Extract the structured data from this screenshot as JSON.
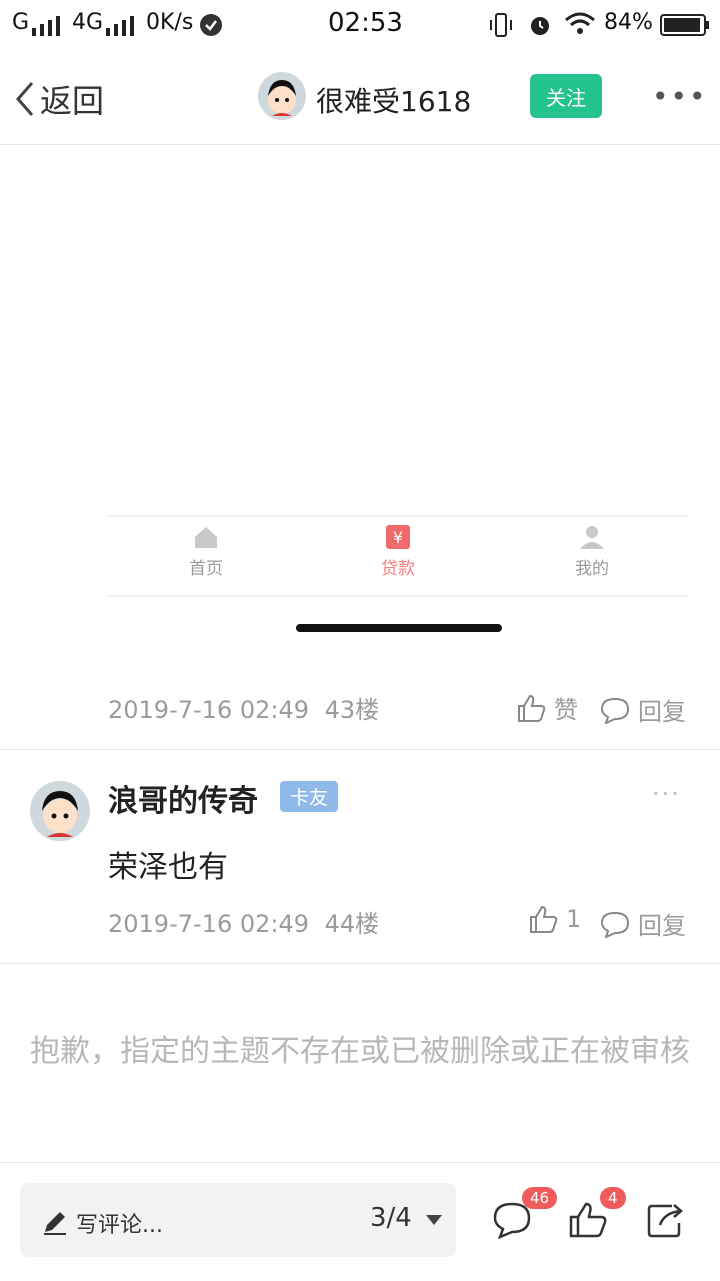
{
  "status_bar": {
    "signal1": "G",
    "signal2": "4G",
    "speed": "0K/s",
    "time": "02:53",
    "battery": "84%"
  },
  "header": {
    "back_label": "返回",
    "username": "很难受1618",
    "follow_label": "关注",
    "more_label": "•••"
  },
  "embedded_screenshot": {
    "tabs": [
      {
        "label": "首页",
        "icon": "home-icon"
      },
      {
        "label": "贷款",
        "icon": "yen-icon"
      },
      {
        "label": "我的",
        "icon": "person-icon"
      }
    ]
  },
  "post43": {
    "datetime": "2019-7-16 02:49",
    "floor": "43楼",
    "like_label": "赞",
    "reply_label": "回复"
  },
  "post44": {
    "username": "浪哥的传奇",
    "badge": "卡友",
    "comment": "荣泽也有",
    "datetime": "2019-7-16 02:49",
    "floor": "44楼",
    "like_count": "1",
    "reply_label": "回复",
    "more_label": "···"
  },
  "notice": "抱歉，指定的主题不存在或已被删除或正在被审核",
  "bottom_bar": {
    "write_label": "写评论...",
    "page_indicator": "3/4",
    "comments_count": "46",
    "likes_count": "4"
  },
  "colors": {
    "accent_green": "#23c28e",
    "badge_blue": "#8fb9e9",
    "count_red": "#ef5b5b"
  }
}
